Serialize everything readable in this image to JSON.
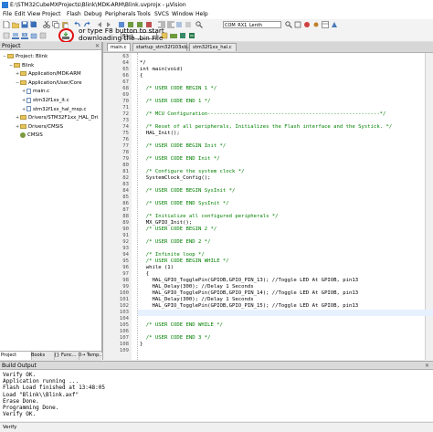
{
  "window": {
    "title": "E:\\STM32CubeMXProjects\\Blink\\MDK-ARM\\Blink.uvprojx - µVision"
  },
  "menu": [
    "File",
    "Edit",
    "View",
    "Project",
    "Flash",
    "Debug",
    "Peripherals",
    "Tools",
    "SVCS",
    "Window",
    "Help"
  ],
  "toolbar": {
    "combo_search": "COM_RX1_Lenth",
    "combo_target": "Blink"
  },
  "annotation": {
    "line1": "or type F8 button to start",
    "line2": "downloading the .bin File"
  },
  "project_pane": {
    "title": "Project",
    "tree": [
      {
        "label": "Project: Blink",
        "indent": 0,
        "kind": "project",
        "exp": "−"
      },
      {
        "label": "Blink",
        "indent": 1,
        "kind": "folder",
        "exp": "−"
      },
      {
        "label": "Application/MDK-ARM",
        "indent": 2,
        "kind": "folder",
        "exp": "+"
      },
      {
        "label": "Application/User/Core",
        "indent": 2,
        "kind": "folder",
        "exp": "−"
      },
      {
        "label": "main.c",
        "indent": 3,
        "kind": "file",
        "exp": "+"
      },
      {
        "label": "stm32f1xx_it.c",
        "indent": 3,
        "kind": "file",
        "exp": "+"
      },
      {
        "label": "stm32f1xx_hal_msp.c",
        "indent": 3,
        "kind": "file",
        "exp": "+"
      },
      {
        "label": "Drivers/STM32F1xx_HAL_Dri",
        "indent": 2,
        "kind": "folder",
        "exp": "+"
      },
      {
        "label": "Drivers/CMSIS",
        "indent": 2,
        "kind": "folder",
        "exp": "+"
      },
      {
        "label": "CMSIS",
        "indent": 2,
        "kind": "gear",
        "exp": ""
      }
    ],
    "tabs": [
      "Project",
      "Books",
      "{} Func...",
      "0→ Temp..."
    ]
  },
  "editor": {
    "tabs": [
      "main.c",
      "startup_stm32f103xb.s",
      "stm32f1xx_hal.c"
    ],
    "lines": [
      {
        "n": "63",
        "t": ""
      },
      {
        "n": "64",
        "t": "*/"
      },
      {
        "n": "65",
        "t": "int main(void)"
      },
      {
        "n": "66",
        "t": "{"
      },
      {
        "n": "67",
        "t": ""
      },
      {
        "n": "68",
        "t": "  /* USER CODE BEGIN 1 */",
        "c": true
      },
      {
        "n": "69",
        "t": ""
      },
      {
        "n": "70",
        "t": "  /* USER CODE END 1 */",
        "c": true
      },
      {
        "n": "71",
        "t": ""
      },
      {
        "n": "72",
        "t": "  /* MCU Configuration--------------------------------------------------------*/",
        "c": true
      },
      {
        "n": "73",
        "t": ""
      },
      {
        "n": "74",
        "t": "  /* Reset of all peripherals, Initializes the Flash interface and the Systick. */",
        "c": true
      },
      {
        "n": "75",
        "t": "  HAL_Init();"
      },
      {
        "n": "76",
        "t": ""
      },
      {
        "n": "77",
        "t": "  /* USER CODE BEGIN Init */",
        "c": true
      },
      {
        "n": "78",
        "t": ""
      },
      {
        "n": "79",
        "t": "  /* USER CODE END Init */",
        "c": true
      },
      {
        "n": "80",
        "t": ""
      },
      {
        "n": "81",
        "t": "  /* Configure the system clock */",
        "c": true
      },
      {
        "n": "82",
        "t": "  SystemClock_Config();"
      },
      {
        "n": "83",
        "t": ""
      },
      {
        "n": "84",
        "t": "  /* USER CODE BEGIN SysInit */",
        "c": true
      },
      {
        "n": "85",
        "t": ""
      },
      {
        "n": "86",
        "t": "  /* USER CODE END SysInit */",
        "c": true
      },
      {
        "n": "87",
        "t": ""
      },
      {
        "n": "88",
        "t": "  /* Initialize all configured peripherals */",
        "c": true
      },
      {
        "n": "89",
        "t": "  MX_GPIO_Init();"
      },
      {
        "n": "90",
        "t": "  /* USER CODE BEGIN 2 */",
        "c": true
      },
      {
        "n": "91",
        "t": ""
      },
      {
        "n": "92",
        "t": "  /* USER CODE END 2 */",
        "c": true
      },
      {
        "n": "93",
        "t": ""
      },
      {
        "n": "94",
        "t": "  /* Infinite loop */",
        "c": true
      },
      {
        "n": "95",
        "t": "  /* USER CODE BEGIN WHILE */",
        "c": true
      },
      {
        "n": "96",
        "t": "  while (1)"
      },
      {
        "n": "97",
        "t": "  {"
      },
      {
        "n": "98",
        "t": "    HAL_GPIO_TogglePin(GPIOB,GPIO_PIN_13); //Toggle LED At GPIOB, pin13"
      },
      {
        "n": "99",
        "t": "    HAL_Delay(300); //Delay 1 Seconds"
      },
      {
        "n": "100",
        "t": "    HAL_GPIO_TogglePin(GPIOB,GPIO_PIN_14); //Toggle LED At GPIOB, pin13"
      },
      {
        "n": "101",
        "t": "    HAL_Delay(300); //Delay 1 Seconds"
      },
      {
        "n": "102",
        "t": "    HAL_GPIO_TogglePin(GPIOB,GPIO_PIN_15); //Toggle LED At GPIOB, pin13"
      },
      {
        "n": "103",
        "t": "    HAL_Delay(300); //Delay 1 Seconds",
        "hl": true
      },
      {
        "n": "104",
        "t": ""
      },
      {
        "n": "105",
        "t": "  /* USER CODE END WHILE */",
        "c": true
      },
      {
        "n": "106",
        "t": ""
      },
      {
        "n": "107",
        "t": "  /* USER CODE END 3 */",
        "c": true
      },
      {
        "n": "108",
        "t": "}"
      },
      {
        "n": "109",
        "t": ""
      }
    ]
  },
  "build_output": {
    "title": "Build Output",
    "lines": [
      "Verify OK.",
      "Application running ...",
      "Flash Load finished at 13:48:05",
      "Load \"Blink\\\\Blink.axf\"",
      "Erase Done.",
      "Programming Done.",
      "Verify OK."
    ]
  },
  "statusbar": {
    "text": "Verify"
  },
  "colors": {
    "comment": "#008000",
    "annotation_circle": "#e01010",
    "folder": "#e8c55c"
  }
}
